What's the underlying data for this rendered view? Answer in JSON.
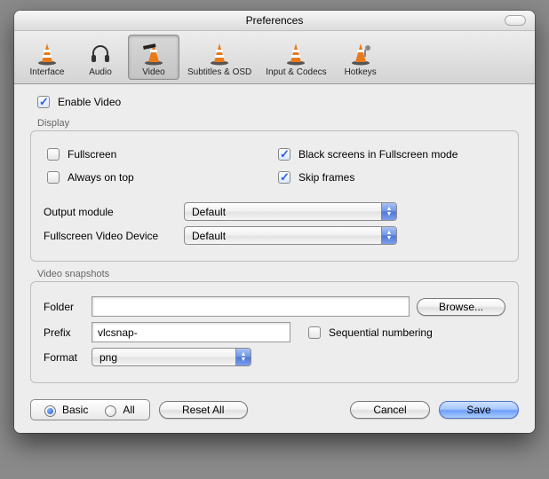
{
  "window": {
    "title": "Preferences"
  },
  "toolbar": {
    "items": [
      {
        "label": "Interface"
      },
      {
        "label": "Audio"
      },
      {
        "label": "Video"
      },
      {
        "label": "Subtitles & OSD"
      },
      {
        "label": "Input & Codecs"
      },
      {
        "label": "Hotkeys"
      }
    ]
  },
  "video": {
    "enable_label": "Enable Video",
    "display": {
      "title": "Display",
      "fullscreen": "Fullscreen",
      "always_on_top": "Always on top",
      "black_screens": "Black screens in Fullscreen mode",
      "skip_frames": "Skip frames",
      "output_module_label": "Output module",
      "output_module_value": "Default",
      "fs_device_label": "Fullscreen Video Device",
      "fs_device_value": "Default"
    },
    "snapshots": {
      "title": "Video snapshots",
      "folder_label": "Folder",
      "folder_value": "",
      "browse": "Browse...",
      "prefix_label": "Prefix",
      "prefix_value": "vlcsnap-",
      "sequential": "Sequential numbering",
      "format_label": "Format",
      "format_value": "png"
    }
  },
  "footer": {
    "basic": "Basic",
    "all": "All",
    "reset": "Reset All",
    "cancel": "Cancel",
    "save": "Save"
  }
}
